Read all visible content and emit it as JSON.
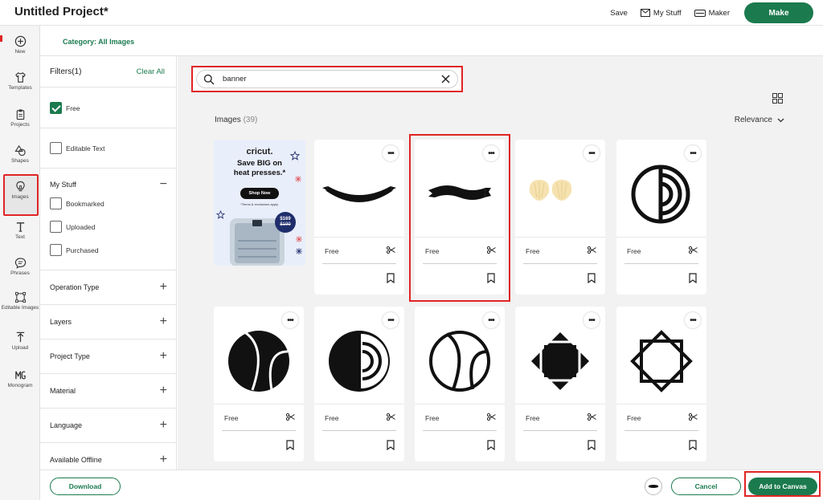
{
  "app": {
    "title": "Untitled Project*"
  },
  "topbar": {
    "save_label": "Save",
    "mystuff_label": "My Stuff",
    "maker_label": "Maker",
    "make_label": "Make",
    "accent": "#1b7a4e"
  },
  "leftnav": {
    "items": [
      {
        "label": "New",
        "icon": "plus-circle-icon"
      },
      {
        "label": "Templates",
        "icon": "shirt-icon"
      },
      {
        "label": "Projects",
        "icon": "clipboard-icon"
      },
      {
        "label": "Shapes",
        "icon": "shapes-icon"
      },
      {
        "label": "Images",
        "icon": "lightbulb-icon",
        "selected": true
      },
      {
        "label": "Text",
        "icon": "text-icon"
      },
      {
        "label": "Phrases",
        "icon": "speech-bubble-icon"
      },
      {
        "label": "Editable Images",
        "icon": "editable-image-icon"
      },
      {
        "label": "Upload",
        "icon": "upload-icon"
      },
      {
        "label": "Monogram",
        "icon": "monogram-icon"
      }
    ]
  },
  "category": {
    "label": "Category: All Images"
  },
  "filters": {
    "title": "Filters(1)",
    "clear_label": "Clear All",
    "free_label": "Free",
    "free_checked": true,
    "editable_text_label": "Editable Text",
    "mystuff_label": "My Stuff",
    "bookmarked_label": "Bookmarked",
    "uploaded_label": "Uploaded",
    "purchased_label": "Purchased",
    "sections": [
      "Operation Type",
      "Layers",
      "Project Type",
      "Material",
      "Language",
      "Available Offline"
    ]
  },
  "search": {
    "value": "banner"
  },
  "results": {
    "heading": "Images",
    "count": "(39)",
    "sort_label": "Relevance",
    "free_label": "Free",
    "cards": [
      {
        "icon": "curved-banner-icon"
      },
      {
        "icon": "ribbon-banner-icon",
        "selected": true
      },
      {
        "icon": "shells-icon"
      },
      {
        "icon": "half-circle-rings-icon"
      },
      {
        "icon": "tennis-ball-icon"
      },
      {
        "icon": "half-circle-rings-solid-icon"
      },
      {
        "icon": "tennis-ball-outline-icon"
      },
      {
        "icon": "diamond-square-icon"
      },
      {
        "icon": "octagram-outline-icon"
      }
    ]
  },
  "ad": {
    "brand": "cricut.",
    "headline_1": "Save BIG on",
    "headline_2": "heat presses.*",
    "cta": "Shop Now",
    "note": "*Terms & exclusions apply.",
    "price_new": "$169",
    "price_old": "$199",
    "bg_color": "#e9eefb"
  },
  "footer": {
    "download_label": "Download",
    "cancel_label": "Cancel",
    "add_label": "Add to Canvas"
  }
}
